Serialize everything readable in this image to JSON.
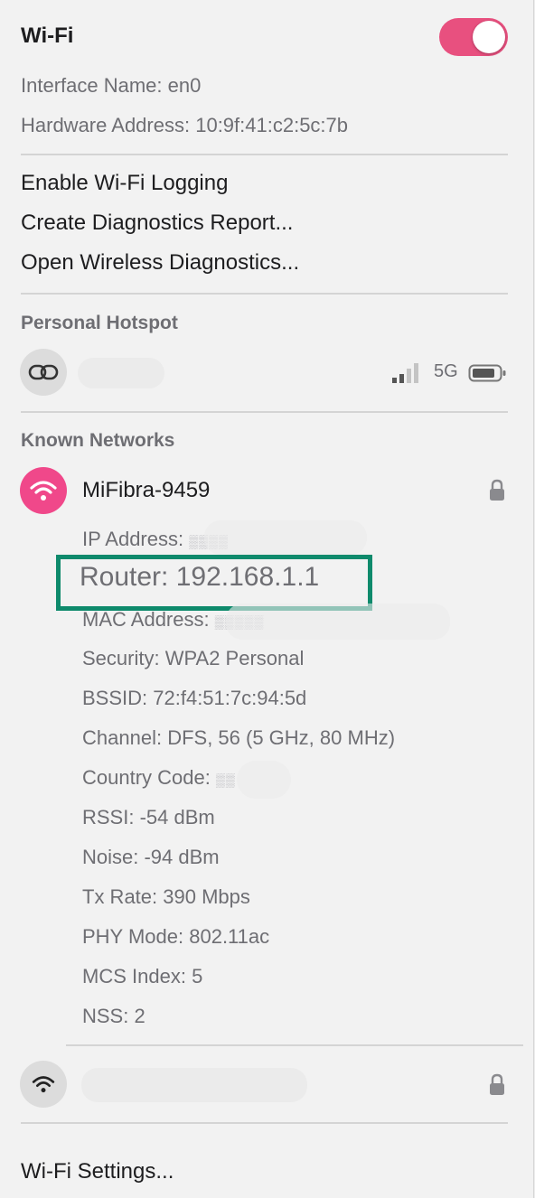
{
  "header": {
    "title": "Wi-Fi",
    "toggle_on": true,
    "accent_color": "#e8507f"
  },
  "interface": {
    "name_label": "Interface Name:",
    "name_value": "en0",
    "hw_label": "Hardware Address:",
    "hw_value": "10:9f:41:c2:5c:7b"
  },
  "menu": {
    "logging": "Enable Wi-Fi Logging",
    "diagnostics_report": "Create Diagnostics Report...",
    "wireless_diagnostics": "Open Wireless Diagnostics..."
  },
  "hotspot": {
    "section_label": "Personal Hotspot",
    "network_type": "5G",
    "icon": "link-icon"
  },
  "known": {
    "section_label": "Known Networks",
    "network_name": "MiFibra-9459",
    "icon": "wifi-icon",
    "details": {
      "ip_label": "IP Address:",
      "ip_value": "obscured",
      "router_label": "Router:",
      "router_value": "192.168.1.1",
      "mac_label": "MAC Address:",
      "mac_value": "obscured",
      "security_label": "Security:",
      "security_value": "WPA2 Personal",
      "bssid_label": "BSSID:",
      "bssid_value": "72:f4:51:7c:94:5d",
      "channel_label": "Channel:",
      "channel_value": "DFS, 56 (5 GHz, 80 MHz)",
      "country_label": "Country Code:",
      "country_value": "obscured",
      "rssi_label": "RSSI:",
      "rssi_value": "-54 dBm",
      "noise_label": "Noise:",
      "noise_value": "-94 dBm",
      "tx_label": "Tx Rate:",
      "tx_value": "390 Mbps",
      "phy_label": "PHY Mode:",
      "phy_value": "802.11ac",
      "mcs_label": "MCS Index:",
      "mcs_value": "5",
      "nss_label": "NSS:",
      "nss_value": "2"
    }
  },
  "footer": {
    "settings": "Wi-Fi Settings..."
  },
  "colors": {
    "highlight_box": "#0e8a6c",
    "wifi_circle": "#f0488a"
  }
}
